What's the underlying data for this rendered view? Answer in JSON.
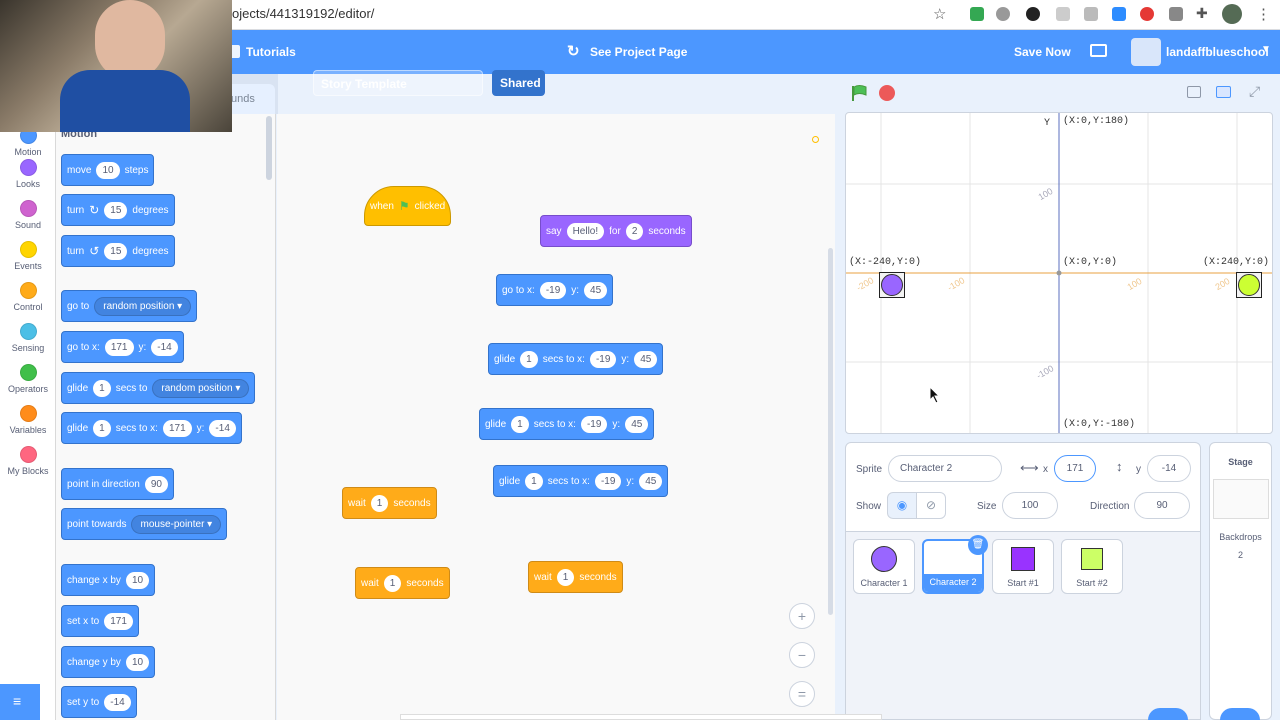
{
  "browser": {
    "url": "ojects/441319192/editor/"
  },
  "menubar": {
    "tutorials": "Tutorials",
    "title": "Story Template",
    "shared": "Shared",
    "see_project": "See Project Page",
    "save_now": "Save Now",
    "username": "landaffblueschool"
  },
  "tabs": {
    "sounds": "unds"
  },
  "categories": [
    {
      "label": "Motion",
      "color": "#4c97ff"
    },
    {
      "label": "Looks",
      "color": "#9966ff"
    },
    {
      "label": "Sound",
      "color": "#cf63cf"
    },
    {
      "label": "Events",
      "color": "#ffd500"
    },
    {
      "label": "Control",
      "color": "#ffab19"
    },
    {
      "label": "Sensing",
      "color": "#4cbfe6"
    },
    {
      "label": "Operators",
      "color": "#40bf4a"
    },
    {
      "label": "Variables",
      "color": "#ff8c1a"
    },
    {
      "label": "My Blocks",
      "color": "#ff6680"
    }
  ],
  "palette": {
    "heading": "Motion",
    "move": {
      "a": "move",
      "n": "10",
      "b": "steps"
    },
    "turn_right": {
      "a": "turn",
      "n": "15",
      "b": "degrees"
    },
    "turn_left": {
      "a": "turn",
      "n": "15",
      "b": "degrees"
    },
    "goto": {
      "a": "go to",
      "dd": "random position"
    },
    "gotoxy": {
      "a": "go to x:",
      "x": "171",
      "b": "y:",
      "y": "-14"
    },
    "glide_to": {
      "a": "glide",
      "n": "1",
      "b": "secs to",
      "dd": "random position"
    },
    "glide_xy": {
      "a": "glide",
      "n": "1",
      "b": "secs to x:",
      "x": "171",
      "c": "y:",
      "y": "-14"
    },
    "point_dir": {
      "a": "point in direction",
      "n": "90"
    },
    "point_towards": {
      "a": "point towards",
      "dd": "mouse-pointer"
    },
    "change_x": {
      "a": "change x by",
      "n": "10"
    },
    "set_x": {
      "a": "set x to",
      "n": "171"
    },
    "change_y": {
      "a": "change y by",
      "n": "10"
    },
    "set_y": {
      "a": "set y to",
      "n": "-14"
    }
  },
  "workspace": {
    "when_clicked": {
      "a": "when",
      "b": "clicked"
    },
    "say": {
      "a": "say",
      "msg": "Hello!",
      "b": "for",
      "n": "2",
      "c": "seconds"
    },
    "gotoxy": {
      "a": "go to x:",
      "x": "-19",
      "b": "y:",
      "y": "45"
    },
    "glide1": {
      "a": "glide",
      "n": "1",
      "b": "secs to x:",
      "x": "-19",
      "c": "y:",
      "y": "45"
    },
    "glide2": {
      "a": "glide",
      "n": "1",
      "b": "secs to x:",
      "x": "-19",
      "c": "y:",
      "y": "45"
    },
    "glide3": {
      "a": "glide",
      "n": "1",
      "b": "secs to x:",
      "x": "-19",
      "c": "y:",
      "y": "45"
    },
    "wait1": {
      "a": "wait",
      "n": "1",
      "b": "seconds"
    },
    "wait2": {
      "a": "wait",
      "n": "1",
      "b": "seconds"
    },
    "wait3": {
      "a": "wait",
      "n": "1",
      "b": "seconds"
    },
    "zoom_in": "+",
    "zoom_out": "−",
    "zoom_reset": "="
  },
  "stage": {
    "y_axis": "Y",
    "top": "(X:0,Y:180)",
    "bottom": "(X:0,Y:-180)",
    "left": "(X:-240,Y:0)",
    "center": "(X:0,Y:0)",
    "right": "(X:240,Y:0)",
    "ticks": [
      "100",
      "-100",
      "-200",
      "-100",
      "100",
      "200",
      "-100"
    ]
  },
  "sprite_info": {
    "sprite_label": "Sprite",
    "sprite_name": "Character 2",
    "x_label": "x",
    "x": "171",
    "y_label": "y",
    "y": "-14",
    "show_label": "Show",
    "size_label": "Size",
    "size": "100",
    "direction_label": "Direction",
    "direction": "90"
  },
  "sprites": [
    {
      "name": "Character 1",
      "shape": "circle",
      "color": "#9966ff"
    },
    {
      "name": "Character 2",
      "shape": "blank",
      "color": "#ffffff"
    },
    {
      "name": "Start #1",
      "shape": "square",
      "color": "#9933ff"
    },
    {
      "name": "Start #2",
      "shape": "square",
      "color": "#ccff66"
    }
  ],
  "stage_panel": {
    "title": "Stage",
    "backdrops_label": "Backdrops",
    "backdrops": "2"
  }
}
